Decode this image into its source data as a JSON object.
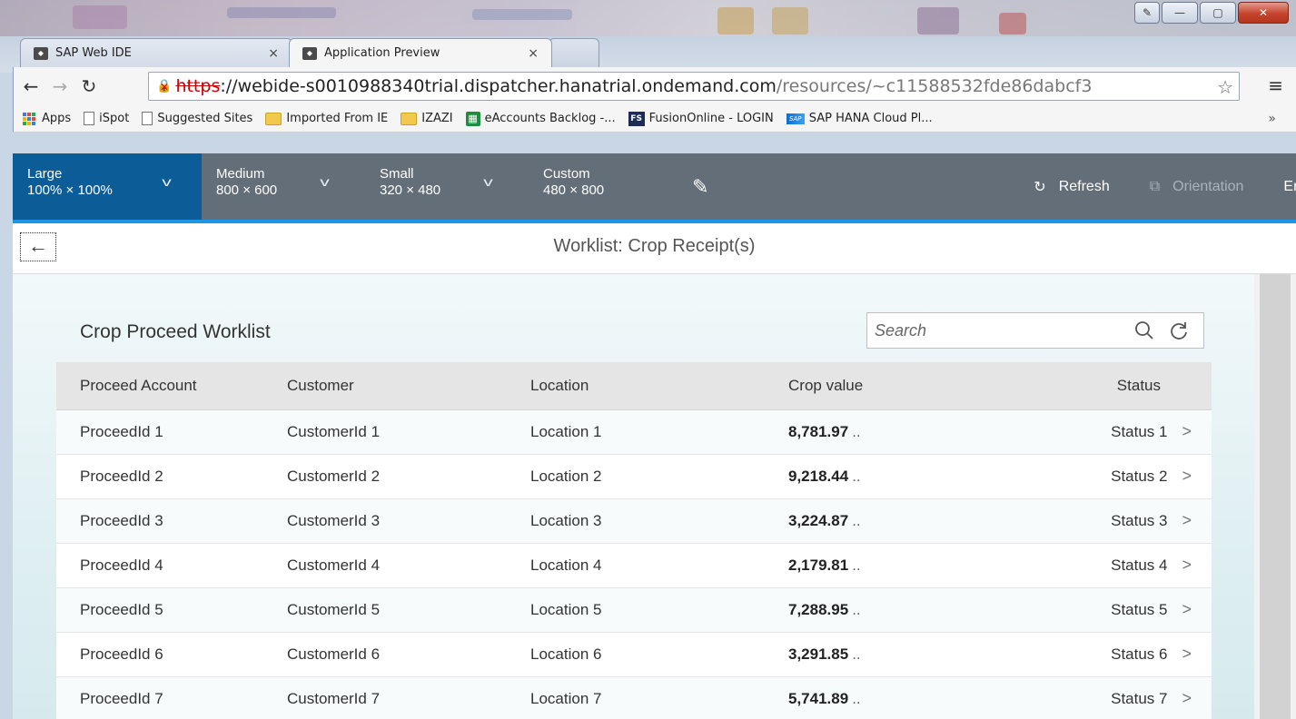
{
  "browser": {
    "tabs": [
      {
        "label": "SAP Web IDE",
        "active": false
      },
      {
        "label": "Application Preview",
        "active": true
      }
    ],
    "tab_close_glyph": "×",
    "url": {
      "scheme": "https",
      "separator": "://",
      "host": "webide-s0010988340trial.dispatcher.hanatrial.ondemand.com",
      "path": "/resources/~c11588532fde86dabcf3"
    },
    "bookmarks": [
      {
        "label": "Apps",
        "icon": "apps-grid-icon"
      },
      {
        "label": "iSpot",
        "icon": "page-icon"
      },
      {
        "label": "Suggested Sites",
        "icon": "page-icon"
      },
      {
        "label": "Imported From IE",
        "icon": "folder-icon"
      },
      {
        "label": "IZAZI",
        "icon": "folder-icon"
      },
      {
        "label": "eAccounts Backlog -...",
        "icon": "sheets-icon"
      },
      {
        "label": "FusionOnline - LOGIN",
        "icon": "fusion-icon"
      },
      {
        "label": "SAP HANA Cloud Pl...",
        "icon": "sap-icon"
      }
    ],
    "bookmarks_more": "»"
  },
  "preview_bar": {
    "devices": [
      {
        "name": "Large",
        "size": "100% × 100%",
        "active": true
      },
      {
        "name": "Medium",
        "size": "800 × 600",
        "active": false
      },
      {
        "name": "Small",
        "size": "320 × 480",
        "active": false
      },
      {
        "name": "Custom",
        "size": "480 × 800",
        "active": false
      }
    ],
    "refresh_label": "Refresh",
    "orientation_label": "Orientation",
    "language_label": "En",
    "active_color": "#0b5c97",
    "bar_color": "#646e78",
    "accent_line": "#1c96e8"
  },
  "app": {
    "title": "Worklist: Crop Receipt(s)",
    "panel_title": "Crop Proceed Worklist",
    "search_placeholder": "Search",
    "columns": [
      "Proceed Account",
      "Customer",
      "Location",
      "Crop value",
      "Status"
    ],
    "rows": [
      {
        "account": "ProceedId 1",
        "customer": "CustomerId 1",
        "location": "Location 1",
        "value": "8,781.97",
        "value_suffix": "..",
        "status": "Status 1"
      },
      {
        "account": "ProceedId 2",
        "customer": "CustomerId 2",
        "location": "Location 2",
        "value": "9,218.44",
        "value_suffix": "..",
        "status": "Status 2"
      },
      {
        "account": "ProceedId 3",
        "customer": "CustomerId 3",
        "location": "Location 3",
        "value": "3,224.87",
        "value_suffix": "..",
        "status": "Status 3"
      },
      {
        "account": "ProceedId 4",
        "customer": "CustomerId 4",
        "location": "Location 4",
        "value": "2,179.81",
        "value_suffix": "..",
        "status": "Status 4"
      },
      {
        "account": "ProceedId 5",
        "customer": "CustomerId 5",
        "location": "Location 5",
        "value": "7,288.95",
        "value_suffix": "..",
        "status": "Status 5"
      },
      {
        "account": "ProceedId 6",
        "customer": "CustomerId 6",
        "location": "Location 6",
        "value": "3,291.85",
        "value_suffix": "..",
        "status": "Status 6"
      },
      {
        "account": "ProceedId 7",
        "customer": "CustomerId 7",
        "location": "Location 7",
        "value": "5,741.89",
        "value_suffix": "..",
        "status": "Status 7"
      }
    ]
  }
}
